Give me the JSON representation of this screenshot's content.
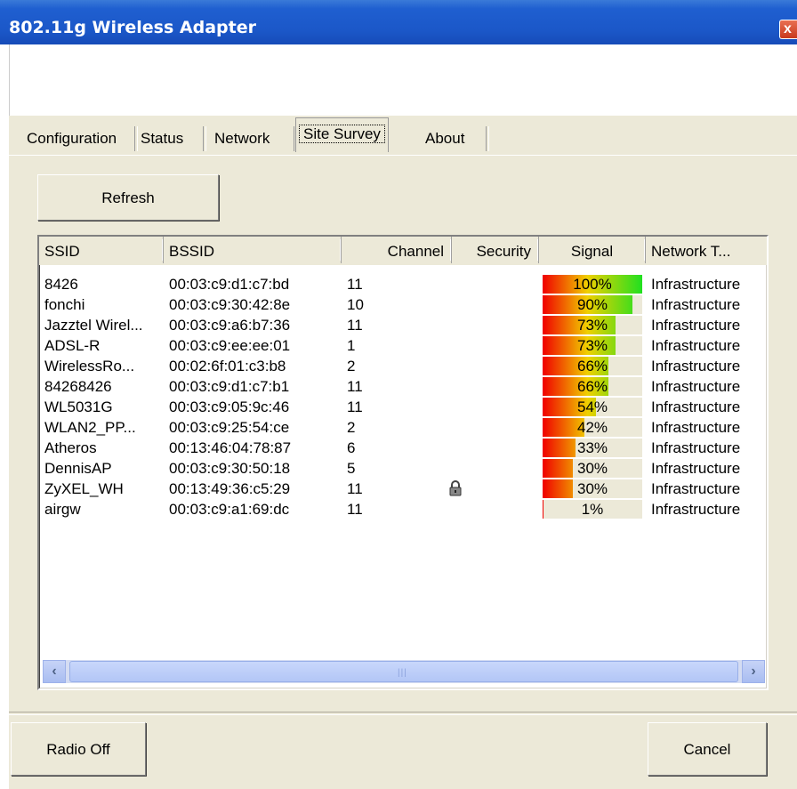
{
  "window": {
    "title": "802.11g Wireless Adapter",
    "close_glyph": "x"
  },
  "tabs": [
    "Configuration",
    "Status",
    "Network",
    "Site Survey",
    "About"
  ],
  "active_tab": "Site Survey",
  "refresh_label": "Refresh",
  "columns": [
    "SSID",
    "BSSID",
    "Channel",
    "Security",
    "Signal",
    "Network T..."
  ],
  "rows": [
    {
      "ssid": "8426",
      "bssid": "00:03:c9:d1:c7:bd",
      "channel": "11",
      "secured": false,
      "signal": "100%",
      "signal_pct": 100,
      "type": "Infrastructure"
    },
    {
      "ssid": "fonchi",
      "bssid": "00:03:c9:30:42:8e",
      "channel": "10",
      "secured": false,
      "signal": "90%",
      "signal_pct": 90,
      "type": "Infrastructure"
    },
    {
      "ssid": "Jazztel Wirel...",
      "bssid": "00:03:c9:a6:b7:36",
      "channel": "11",
      "secured": false,
      "signal": "73%",
      "signal_pct": 73,
      "type": "Infrastructure"
    },
    {
      "ssid": "ADSL-R",
      "bssid": "00:03:c9:ee:ee:01",
      "channel": "1",
      "secured": false,
      "signal": "73%",
      "signal_pct": 73,
      "type": "Infrastructure"
    },
    {
      "ssid": "WirelessRo...",
      "bssid": "00:02:6f:01:c3:b8",
      "channel": "2",
      "secured": false,
      "signal": "66%",
      "signal_pct": 66,
      "type": "Infrastructure"
    },
    {
      "ssid": "84268426",
      "bssid": "00:03:c9:d1:c7:b1",
      "channel": "11",
      "secured": false,
      "signal": "66%",
      "signal_pct": 66,
      "type": "Infrastructure"
    },
    {
      "ssid": "WL5031G",
      "bssid": "00:03:c9:05:9c:46",
      "channel": "11",
      "secured": false,
      "signal": "54%",
      "signal_pct": 54,
      "type": "Infrastructure"
    },
    {
      "ssid": "WLAN2_PP...",
      "bssid": "00:03:c9:25:54:ce",
      "channel": "2",
      "secured": false,
      "signal": "42%",
      "signal_pct": 42,
      "type": "Infrastructure"
    },
    {
      "ssid": "Atheros",
      "bssid": "00:13:46:04:78:87",
      "channel": "6",
      "secured": false,
      "signal": "33%",
      "signal_pct": 33,
      "type": "Infrastructure"
    },
    {
      "ssid": "DennisAP",
      "bssid": "00:03:c9:30:50:18",
      "channel": "5",
      "secured": false,
      "signal": "30%",
      "signal_pct": 30,
      "type": "Infrastructure"
    },
    {
      "ssid": "ZyXEL_WH",
      "bssid": "00:13:49:36:c5:29",
      "channel": "11",
      "secured": true,
      "signal": "30%",
      "signal_pct": 30,
      "type": "Infrastructure"
    },
    {
      "ssid": "airgw",
      "bssid": "00:03:c9:a1:69:dc",
      "channel": "11",
      "secured": false,
      "signal": "1%",
      "signal_pct": 1,
      "type": "Infrastructure"
    }
  ],
  "radio_off_label": "Radio Off",
  "cancel_label": "Cancel",
  "colors": {
    "signal_low": "#f00000",
    "signal_mid": "#f0d000",
    "signal_high": "#20e020",
    "titlebar": "#1b57c8",
    "dialog_bg": "#ece9d8"
  }
}
